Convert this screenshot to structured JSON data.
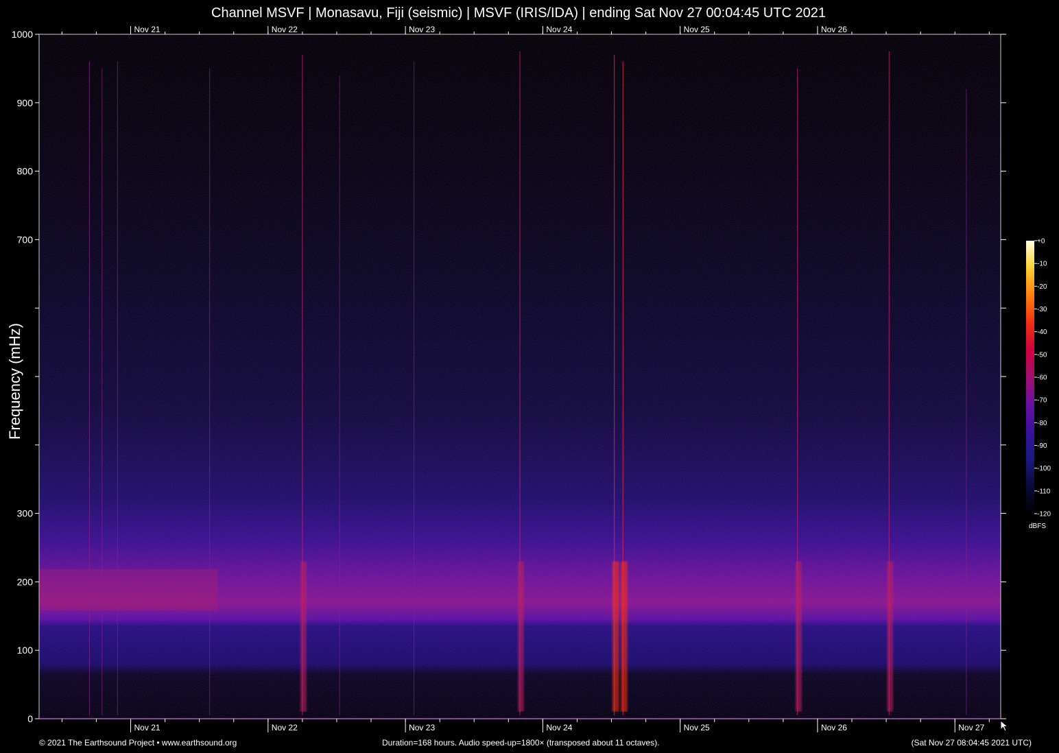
{
  "title": "Channel MSVF | Monasavu, Fiji (seismic) | MSVF (IRIS/IDA) | ending Sat Nov 27 00:04:45 UTC 2021",
  "footer": {
    "left": "© 2021 The Earthsound Project • www.earthsound.org",
    "center": "Duration=168 hours. Audio speed-up=1800× (transposed about 11 octaves).",
    "right": "(Sat Nov 27 08:04:45 2021 UTC)"
  },
  "icons": {
    "cursor": "mouse-pointer-icon"
  },
  "chart_data": {
    "type": "heatmap",
    "title": "Channel MSVF | Monasavu, Fiji (seismic) | MSVF (IRIS/IDA) | ending Sat Nov 27 00:04:45 UTC 2021",
    "ylabel": "Frequency (mHz)",
    "xlabel": "",
    "x_unit": "hours",
    "xlim_hours": [
      0,
      168
    ],
    "ylim": [
      0,
      1000
    ],
    "y_ticks": [
      0,
      100,
      200,
      300,
      400,
      500,
      600,
      700,
      800,
      900,
      1000
    ],
    "y_tick_labels": [
      "0",
      "100",
      "200",
      "300",
      "",
      "",
      "",
      "700",
      "800",
      "900",
      "1000"
    ],
    "x_ticks_top": [
      {
        "label": "Nov 21",
        "hour": 16.0
      },
      {
        "label": "Nov 22",
        "hour": 40.0
      },
      {
        "label": "Nov 23",
        "hour": 64.0
      },
      {
        "label": "Nov 24",
        "hour": 88.0
      },
      {
        "label": "Nov 25",
        "hour": 112.0
      },
      {
        "label": "Nov 26",
        "hour": 136.0
      }
    ],
    "x_ticks_bottom": [
      {
        "label": "Nov 21",
        "hour": 16.0
      },
      {
        "label": "Nov 22",
        "hour": 40.0
      },
      {
        "label": "Nov 23",
        "hour": 64.0
      },
      {
        "label": "Nov 24",
        "hour": 88.0
      },
      {
        "label": "Nov 25",
        "hour": 112.0
      },
      {
        "label": "Nov 26",
        "hour": 136.0
      },
      {
        "label": "Nov 27",
        "hour": 160.0
      }
    ],
    "minor_tick_interval_hours": 6,
    "background_band": {
      "description_peak_mhz": 180,
      "low_cutoff_mhz": 60,
      "shelf_top_mhz": 140
    },
    "events": [
      {
        "hour": 8.8,
        "fmax_mhz": 960,
        "strength": 0.55
      },
      {
        "hour": 11.0,
        "fmax_mhz": 950,
        "strength": 0.35
      },
      {
        "hour": 13.7,
        "fmax_mhz": 960,
        "strength": 0.4
      },
      {
        "hour": 29.8,
        "fmax_mhz": 950,
        "strength": 0.45
      },
      {
        "hour": 46.0,
        "fmax_mhz": 970,
        "strength": 0.75
      },
      {
        "hour": 52.5,
        "fmax_mhz": 940,
        "strength": 0.3
      },
      {
        "hour": 65.5,
        "fmax_mhz": 960,
        "strength": 0.35
      },
      {
        "hour": 84.0,
        "fmax_mhz": 975,
        "strength": 0.7
      },
      {
        "hour": 100.5,
        "fmax_mhz": 970,
        "strength": 0.95
      },
      {
        "hour": 102.0,
        "fmax_mhz": 960,
        "strength": 0.9
      },
      {
        "hour": 132.5,
        "fmax_mhz": 950,
        "strength": 0.8
      },
      {
        "hour": 148.5,
        "fmax_mhz": 975,
        "strength": 0.7
      },
      {
        "hour": 162.0,
        "fmax_mhz": 920,
        "strength": 0.35
      }
    ],
    "colorbar": {
      "unit": "dBFS",
      "ticks": [
        "+0",
        "-10",
        "-20",
        "-30",
        "-40",
        "-50",
        "-60",
        "-70",
        "-80",
        "-90",
        "-100",
        "-110",
        "-120"
      ],
      "colors": [
        "#000000",
        "#0a0a3a",
        "#1a1a80",
        "#3a10a0",
        "#6a10a0",
        "#a01070",
        "#d00040",
        "#f03010",
        "#ff8010",
        "#ffd030",
        "#ffffe0"
      ]
    },
    "grid": false
  }
}
